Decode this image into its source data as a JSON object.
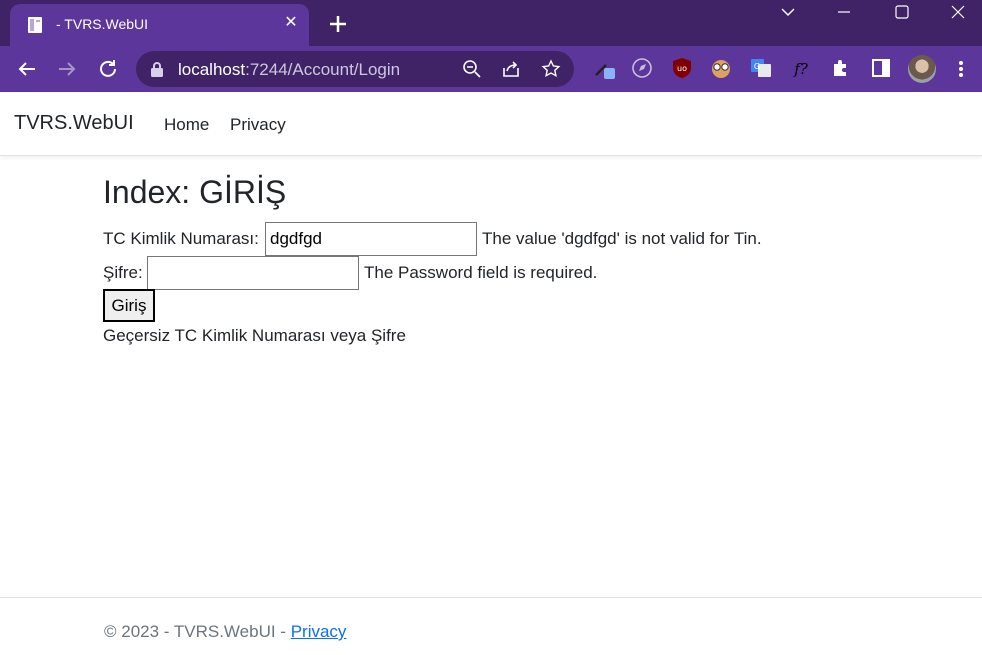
{
  "browser": {
    "tab_title": "- TVRS.WebUI",
    "url_host": "localhost",
    "url_path": ":7244/Account/Login",
    "accent": "#4b2a78"
  },
  "navbar": {
    "brand": "TVRS.WebUI",
    "links": [
      "Home",
      "Privacy"
    ]
  },
  "form": {
    "heading": "Index: GİRİŞ",
    "tc_label": "TC Kimlik Numarası:",
    "tc_value": "dgdfgd",
    "tc_error": "The value 'dgdfgd' is not valid for Tin.",
    "password_label": "Şifre:",
    "password_value": "",
    "password_error": "The Password field is required.",
    "submit_label": "Giriş",
    "summary_error": "Geçersiz TC Kimlik Numarası veya Şifre"
  },
  "footer": {
    "copyright": "© 2023 - TVRS.WebUI - ",
    "link": "Privacy"
  }
}
